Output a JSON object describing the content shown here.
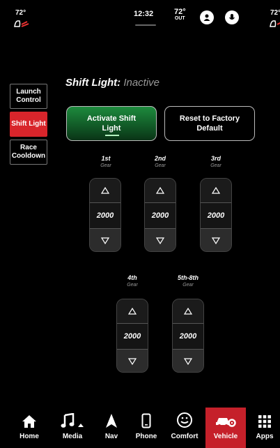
{
  "status_bar": {
    "left_temp": "72°",
    "right_temp": "72°",
    "time": "12:32",
    "outside_temp": "72°",
    "outside_label": "OUT"
  },
  "side_tabs": [
    {
      "label": "Launch Control",
      "active": false
    },
    {
      "label": "Shift Light",
      "active": true
    },
    {
      "label": "Race Cooldown",
      "active": false
    }
  ],
  "title": {
    "main": "Shift Light:",
    "status": "Inactive"
  },
  "buttons": {
    "activate": "Activate Shift Light",
    "reset": "Reset to Factory Default"
  },
  "gears": [
    {
      "name": "1st",
      "sub": "Gear",
      "value": "2000"
    },
    {
      "name": "2nd",
      "sub": "Gear",
      "value": "2000"
    },
    {
      "name": "3rd",
      "sub": "Gear",
      "value": "2000"
    },
    {
      "name": "4th",
      "sub": "Gear",
      "value": "2000"
    },
    {
      "name": "5th-8th",
      "sub": "Gear",
      "value": "2000"
    }
  ],
  "nav": [
    {
      "label": "Home",
      "icon": "home-icon"
    },
    {
      "label": "Media",
      "icon": "music-note-icon"
    },
    {
      "label": "Nav",
      "icon": "navigation-arrow-icon"
    },
    {
      "label": "Phone",
      "icon": "phone-icon"
    },
    {
      "label": "Comfort",
      "icon": "comfort-icon"
    },
    {
      "label": "Vehicle",
      "icon": "vehicle-icon",
      "active": true
    },
    {
      "label": "Apps",
      "icon": "apps-grid-icon"
    }
  ],
  "colors": {
    "accent_red": "#d8252b",
    "activate_green": "#1d8a3d",
    "inactive_gray": "#9a9a9a"
  }
}
